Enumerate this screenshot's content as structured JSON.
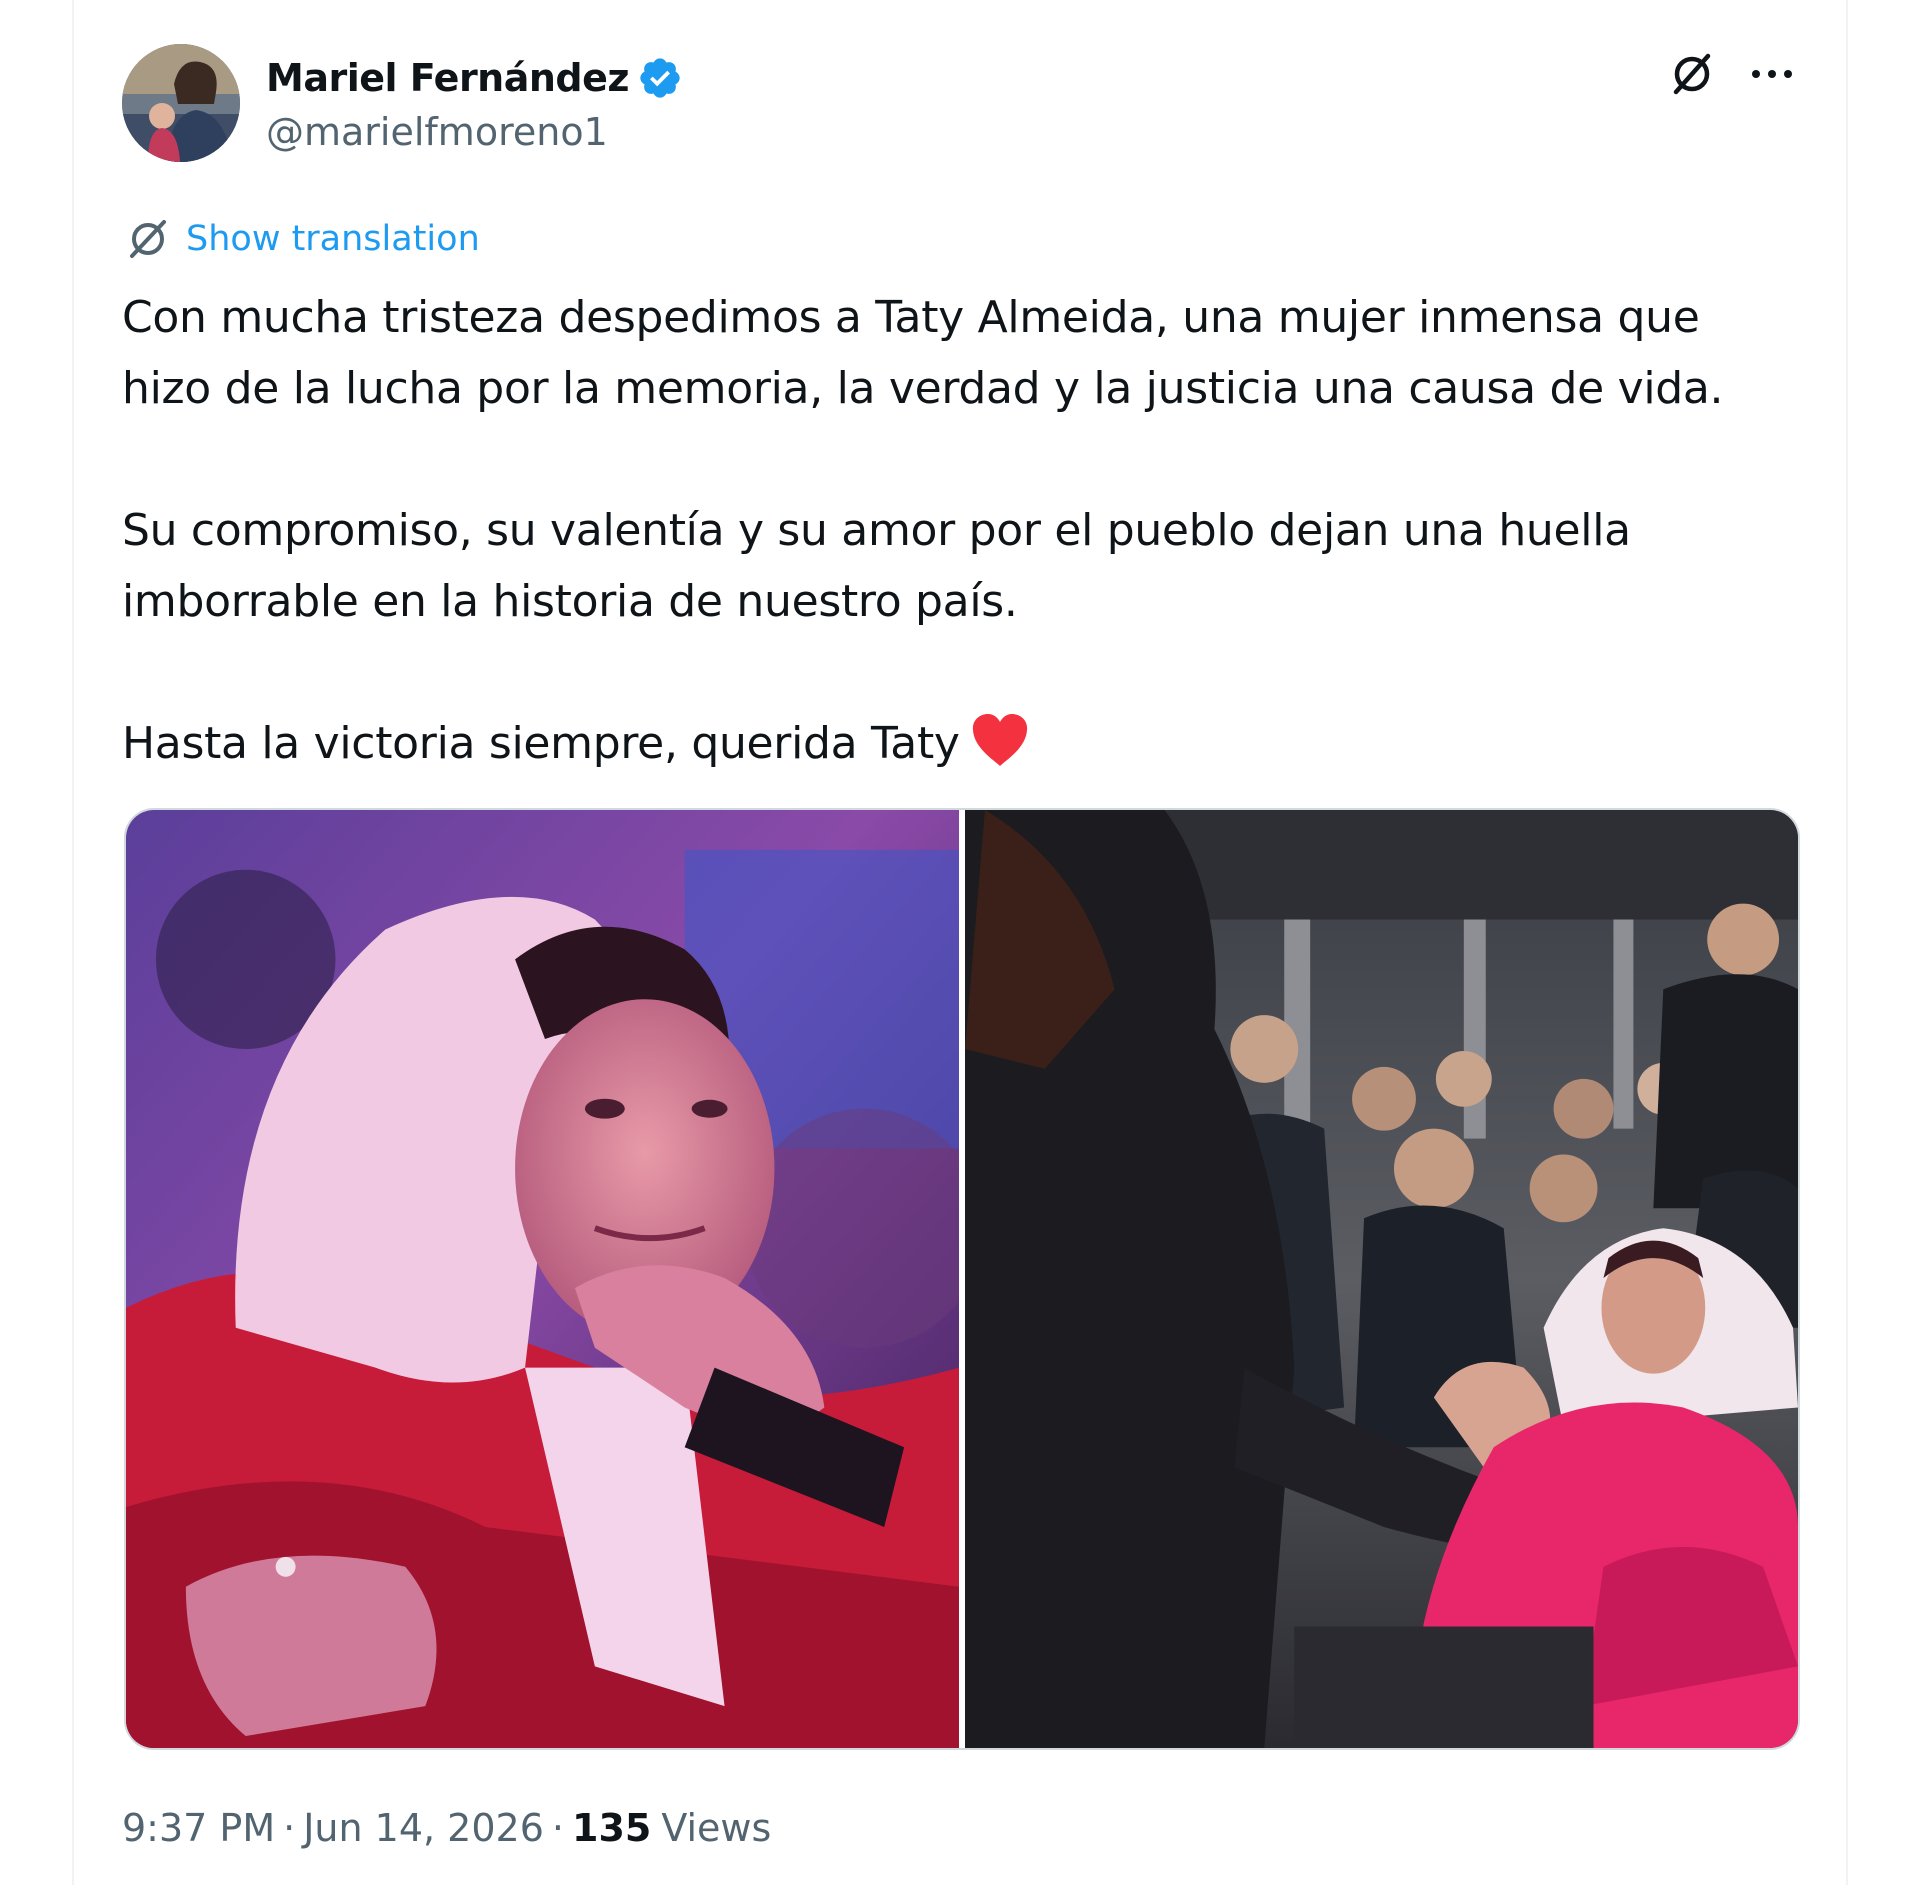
{
  "author": {
    "display_name": "Mariel Fernández",
    "handle": "@marielfmoreno1",
    "verified": true,
    "avatar_icon": "profile-photo"
  },
  "header_actions": {
    "grok_icon": "grok-slash-icon",
    "more_icon": "more-dots-icon"
  },
  "translation": {
    "icon": "grok-slash-icon",
    "label": "Show translation"
  },
  "tweet": {
    "paragraphs": [
      "Con mucha tristeza despedimos a Taty Almeida, una mujer inmensa que\nhizo de la lucha por la memoria, la verdad y la justicia una causa de vida.",
      "Su compromiso, su valentía y su amor por el pueblo dejan una huella\nimborrable en la historia de nuestro país.",
      "Hasta la victoria siempre, querida Taty"
    ],
    "trailing_emoji": "red-heart-icon"
  },
  "media": {
    "photos": [
      {
        "icon": "photo-elderly-woman-white-headscarf"
      },
      {
        "icon": "photo-crowd-greeting-woman"
      }
    ]
  },
  "meta": {
    "time": "9:37 PM",
    "separator": "·",
    "date": "Jun 14, 2026",
    "views_count": "135",
    "views_label": "Views"
  },
  "colors": {
    "accent": "#1d9bf0",
    "text_primary": "#0f1419",
    "text_secondary": "#536471",
    "border": "#cfd9de",
    "heart": "#f4313e"
  }
}
